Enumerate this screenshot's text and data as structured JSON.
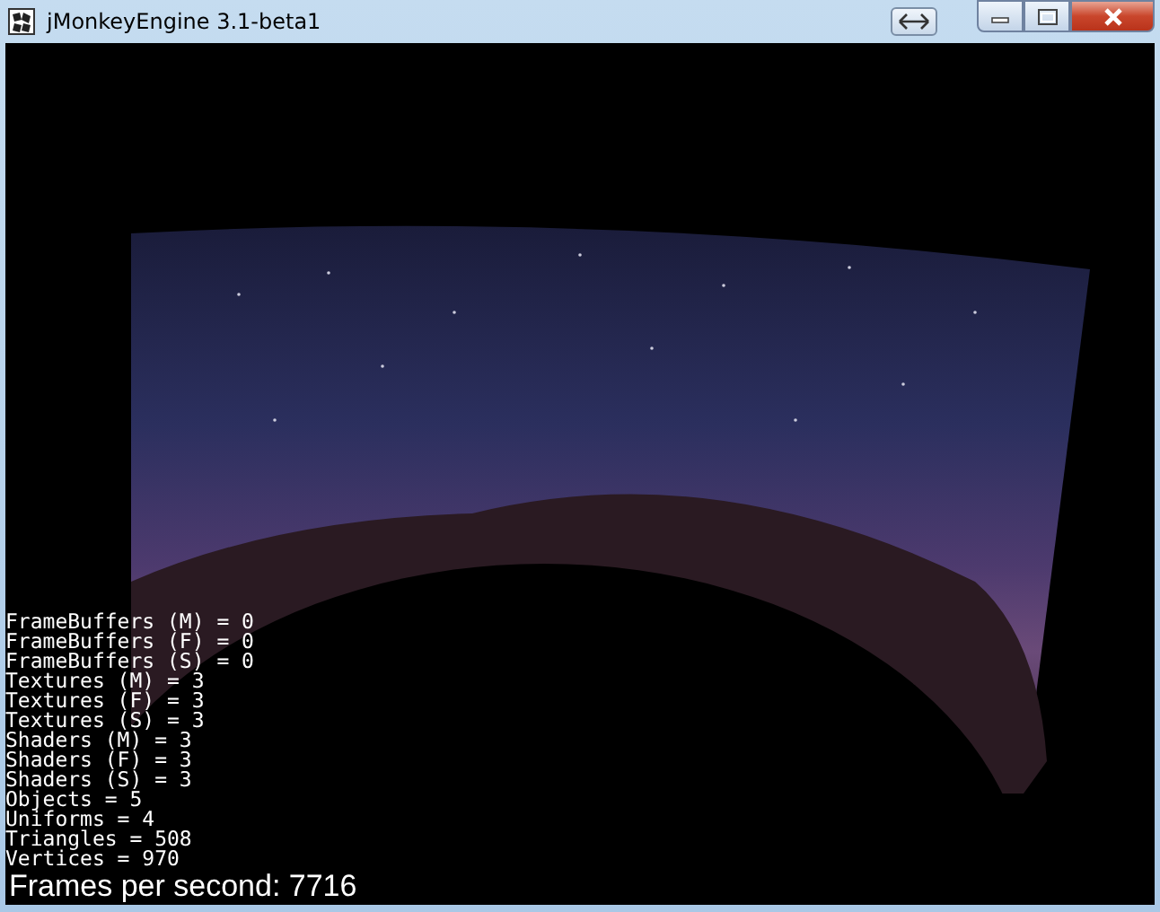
{
  "window": {
    "title": "jMonkeyEngine 3.1-beta1"
  },
  "stats": [
    "FrameBuffers (M) = 0",
    "FrameBuffers (F) = 0",
    "FrameBuffers (S) = 0",
    "Textures (M) = 3",
    "Textures (F) = 3",
    "Textures (S) = 3",
    "Shaders (M) = 3",
    "Shaders (F) = 3",
    "Shaders (S) = 3",
    "Objects = 5",
    "Uniforms = 4",
    "Triangles = 508",
    "Vertices = 970"
  ],
  "fps": "Frames per second: 7716"
}
